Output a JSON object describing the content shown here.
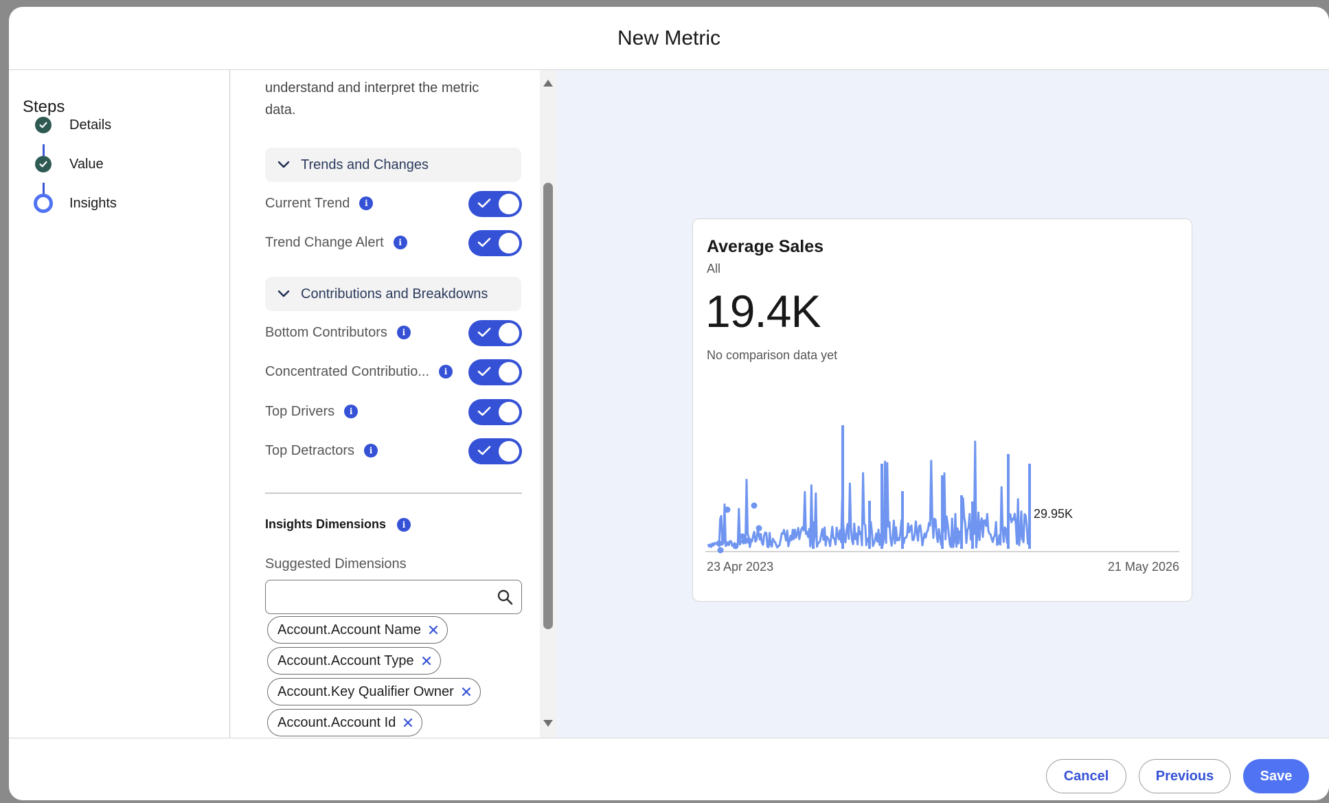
{
  "modal": {
    "title": "New Metric"
  },
  "steps": {
    "title": "Steps",
    "items": [
      {
        "label": "Details",
        "state": "complete"
      },
      {
        "label": "Value",
        "state": "complete"
      },
      {
        "label": "Insights",
        "state": "current"
      }
    ]
  },
  "settings": {
    "description": "understand and interpret the metric data.",
    "sections": [
      {
        "title": "Trends and Changes",
        "toggles": [
          {
            "label": "Current Trend",
            "on": true
          },
          {
            "label": "Trend Change Alert",
            "on": true
          }
        ]
      },
      {
        "title": "Contributions and Breakdowns",
        "toggles": [
          {
            "label": "Bottom Contributors",
            "on": true
          },
          {
            "label": "Concentrated Contributio...",
            "on": true
          },
          {
            "label": "Top Drivers",
            "on": true
          },
          {
            "label": "Top Detractors",
            "on": true
          }
        ]
      }
    ],
    "dimensions": {
      "title": "Insights Dimensions",
      "suggested_label": "Suggested Dimensions",
      "search_value": "",
      "pills": [
        "Account.Account Name",
        "Account.Account Type",
        "Account.Key Qualifier Owner",
        "Account.Account Id"
      ]
    }
  },
  "preview": {
    "title": "Average Sales",
    "subtitle": "All",
    "value": "19.4K",
    "note": "No comparison data yet"
  },
  "chart_data": {
    "type": "line",
    "x_start": "23 Apr 2023",
    "x_end": "21 May 2026",
    "last_value_label": "29.95K",
    "line_color": "#6f95f0"
  },
  "footer": {
    "cancel": "Cancel",
    "previous": "Previous",
    "save": "Save"
  }
}
